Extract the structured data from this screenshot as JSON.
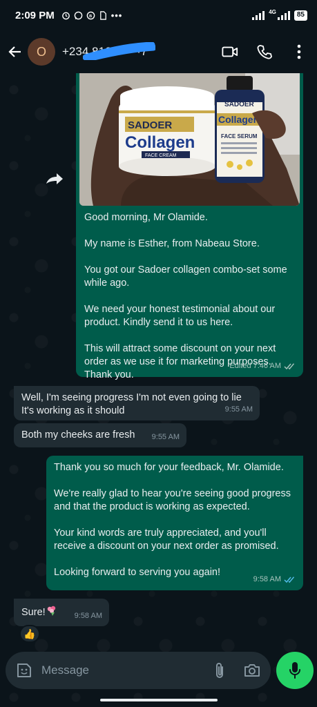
{
  "status_bar": {
    "time": "2:09 PM",
    "icons": [
      "alarm-icon",
      "whatsapp-icon",
      "whatsapp-business-icon",
      "file-icon",
      "more-dots-icon"
    ],
    "network": "4G",
    "battery": "85"
  },
  "header": {
    "avatar_initial": "O",
    "contact_name": "+234 816 ·· ·· ·7",
    "actions": [
      "video-call-icon",
      "voice-call-icon",
      "overflow-menu-icon"
    ]
  },
  "messages": [
    {
      "direction": "out",
      "has_image": true,
      "image_text": {
        "jar_brand": "SADOER",
        "jar_title": "Collagen",
        "jar_subtitle": "FACE CREAM",
        "serum_brand": "SADOER",
        "serum_title": "Collagen",
        "serum_subtitle": "FACE SERUM"
      },
      "paragraphs": [
        "Good morning, Mr Olamide.",
        "My name is Esther, from Nabeau Store.",
        "You got our Sadoer collagen combo-set some while ago.",
        "We need your honest testimonial about our product. Kindly send it to us here.",
        "This will attract some discount on your next order as we use it for marketing purposes. Thank you."
      ],
      "meta": "Edited 7:46 AM"
    },
    {
      "direction": "in",
      "text": "Well, I'm seeing progress I'm not even going to lie It's working as it should",
      "time": "9:55 AM"
    },
    {
      "direction": "in",
      "text": "Both my cheeks are fresh",
      "time": "9:55 AM"
    },
    {
      "direction": "out",
      "paragraphs": [
        "Thank you so much for your feedback, Mr. Olamide.",
        "We're really glad to hear you're seeing good progress and that the product is working as expected.",
        "Your kind words are truly appreciated, and you'll receive a discount on your next order as promised.",
        "Looking forward to serving you again!"
      ],
      "time": "9:58 AM"
    },
    {
      "direction": "in",
      "text": "Sure!",
      "time": "9:58 AM",
      "reaction": "👍"
    }
  ],
  "composer": {
    "placeholder": "Message"
  },
  "colors": {
    "background": "#0b141a",
    "outgoing_bubble": "#005c4b",
    "incoming_bubble": "#202c33",
    "read_ticks": "#53bdeb",
    "mic_button": "#25d366"
  }
}
